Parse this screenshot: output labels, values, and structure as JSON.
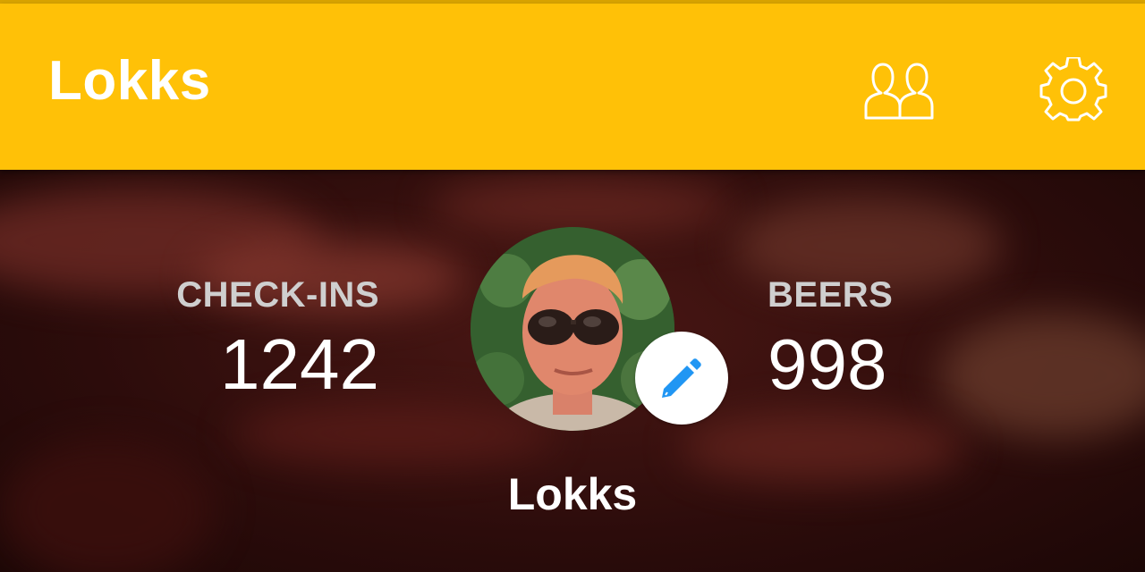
{
  "app_bar": {
    "title": "Lokks",
    "background_color": "#ffc107",
    "icons": [
      "friends-icon",
      "settings-icon"
    ]
  },
  "profile": {
    "checkins": {
      "label": "CHECK-INS",
      "value": "1242"
    },
    "beers": {
      "label": "BEERS",
      "value": "998"
    },
    "username": "Lokks",
    "edit_icon": "pencil-icon",
    "accent_color": "#2196f3"
  }
}
